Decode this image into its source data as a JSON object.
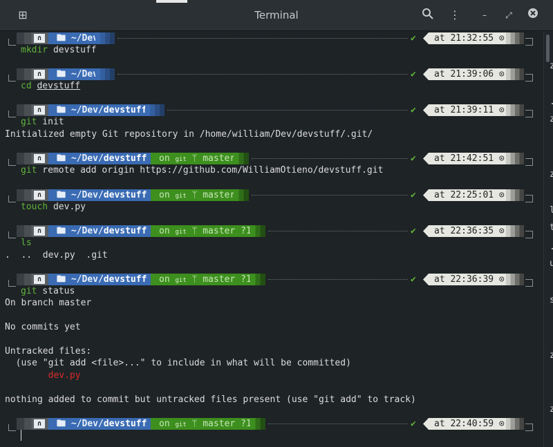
{
  "window": {
    "title": "Terminal"
  },
  "titlebar": {
    "new_tab_icon": "new-tab-icon",
    "search_icon": "search-icon",
    "menu_icon": "kebab-menu-icon",
    "minimize_icon": "minimize-icon",
    "maximize_icon": "maximize-icon",
    "close_icon": "close-icon"
  },
  "prompts": [
    {
      "os": "🐧",
      "dir_prefix": "~/Dev",
      "dir_leaf": "",
      "git": "",
      "time": "at 21:32:55 ⊙",
      "cmd": "mkdir devstuff"
    },
    {
      "os": "🐧",
      "dir_prefix": "~/Dev",
      "dir_leaf": "",
      "git": "",
      "time": "at 21:39:06 ⊙",
      "cmd": "cd devstuff"
    },
    {
      "os": "🐧",
      "dir_prefix": "~/Dev/",
      "dir_leaf": "devstuff",
      "git": "",
      "time": "at 21:39:11 ⊙",
      "cmd": "git init"
    },
    {
      "os": "🐧",
      "dir_prefix": "~/Dev/",
      "dir_leaf": "devstuff",
      "git": "master",
      "time": "at 21:42:51 ⊙",
      "cmd": "git remote add origin https://github.com/WilliamOtieno/devstuff.git"
    },
    {
      "os": "🐧",
      "dir_prefix": "~/Dev/",
      "dir_leaf": "devstuff",
      "git": "master",
      "time": "at 22:25:01 ⊙",
      "cmd": "touch dev.py"
    },
    {
      "os": "🐧",
      "dir_prefix": "~/Dev/",
      "dir_leaf": "devstuff",
      "git": "master ?1",
      "time": "at 22:36:35 ⊙",
      "cmd": "ls"
    },
    {
      "os": "🐧",
      "dir_prefix": "~/Dev/",
      "dir_leaf": "devstuff",
      "git": "master ?1",
      "time": "at 22:36:39 ⊙",
      "cmd": "git status"
    },
    {
      "os": "🐧",
      "dir_prefix": "~/Dev/",
      "dir_leaf": "devstuff",
      "git": "master ?1",
      "time": "at 22:40:59 ⊙",
      "cmd": ""
    }
  ],
  "git_prefix": "on",
  "git_icon_text": "git",
  "branch_glyph": "ᛘ",
  "home_glyph": "🖿",
  "check": "✔",
  "output": {
    "init": "Initialized empty Git repository in /home/william/Dev/devstuff/.git/",
    "ls": ".  ..  dev.py  .git",
    "status_1": "On branch master",
    "status_2": "No commits yet",
    "status_3": "Untracked files:",
    "status_4": "  (use \"git add <file>...\" to include in what will be committed)",
    "status_5": "        dev.py",
    "status_6": "nothing added to commit but untracked files present (use \"git add\" to track)"
  },
  "side_chars": [
    "z",
    ".",
    "z",
    "z",
    "l",
    "t",
    ".",
    "u",
    "s",
    "z",
    "z"
  ]
}
